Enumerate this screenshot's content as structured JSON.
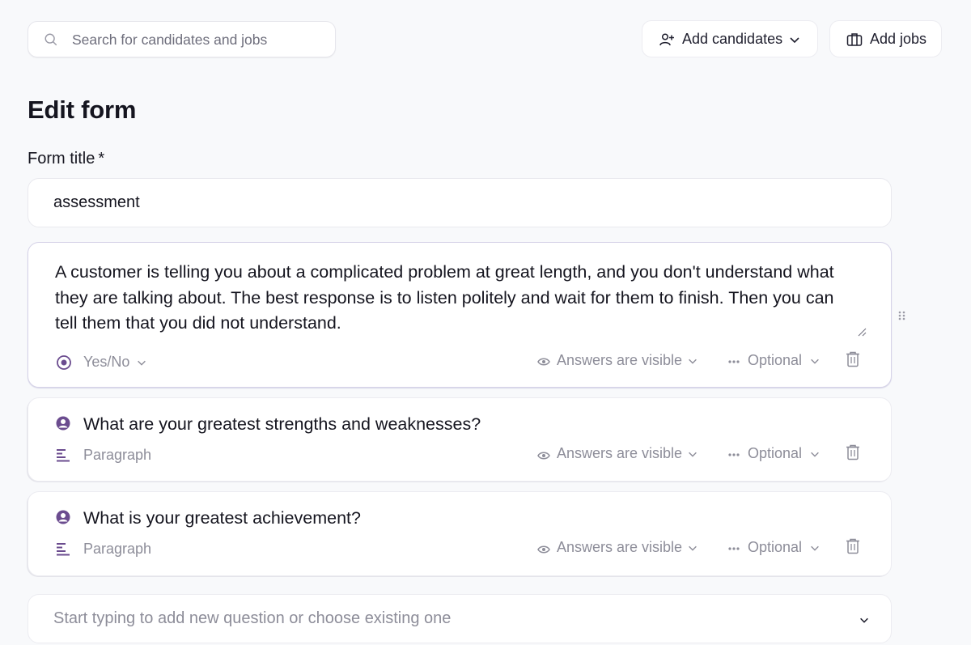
{
  "search": {
    "placeholder": "Search for candidates and jobs",
    "icon": "search-icon"
  },
  "header": {
    "add_candidates_label": "Add candidates",
    "add_jobs_label": "Add jobs"
  },
  "page": {
    "title": "Edit form",
    "form_title_label": "Form title",
    "required_mark": "*",
    "form_title_value": "assessment"
  },
  "questions": [
    {
      "text": "A customer is telling you about a complicated problem at great length, and you don't understand what they are talking about. The best response is to listen politely and wait for them to finish. Then you can tell them that you did not understand.",
      "type": "Yes/No",
      "visibility": "Answers are visible",
      "requirement": "Optional",
      "active": true
    },
    {
      "text": "What are your greatest strengths and weaknesses?",
      "type": "Paragraph",
      "visibility": "Answers are visible",
      "requirement": "Optional",
      "active": false
    },
    {
      "text": "What is your greatest achievement?",
      "type": "Paragraph",
      "visibility": "Answers are visible",
      "requirement": "Optional",
      "active": false
    }
  ],
  "add_question": {
    "placeholder": "Start typing to add new question or choose existing one"
  },
  "colors": {
    "accent": "#6b4c8f",
    "muted": "#8d8d99",
    "background": "#f8f9fb"
  }
}
